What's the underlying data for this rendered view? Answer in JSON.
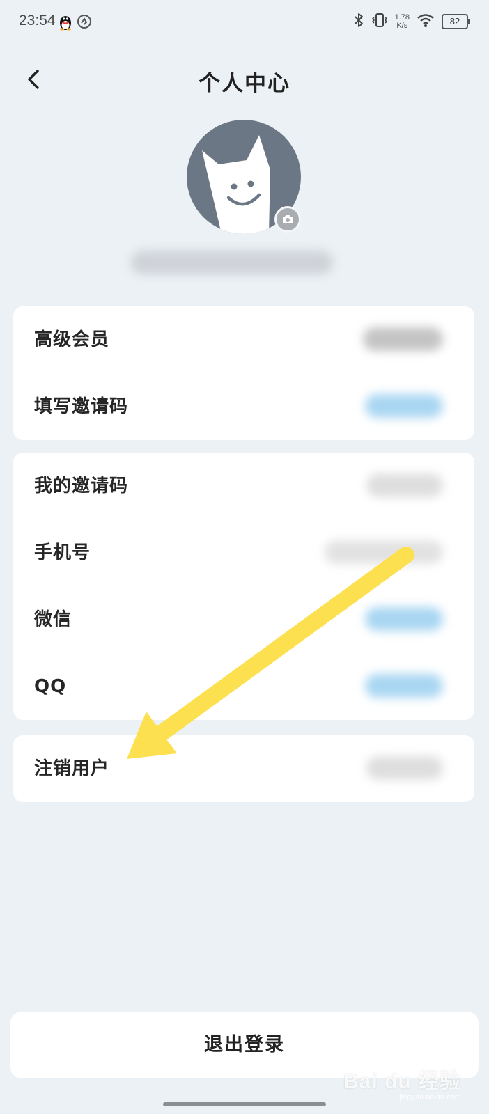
{
  "status_bar": {
    "time": "23:54",
    "net_speed_value": "1.78",
    "net_speed_unit": "K/s",
    "battery": "82",
    "left_icons": [
      "qq-penguin-icon",
      "notification-icon"
    ],
    "right_icons": [
      "bluetooth-icon",
      "vibrate-icon",
      "wifi-icon",
      "battery-icon"
    ]
  },
  "header": {
    "title": "个人中心",
    "back_icon": "chevron-left-icon"
  },
  "profile": {
    "avatar_icon": "cat-avatar-icon",
    "camera_icon": "camera-icon",
    "username": ""
  },
  "groups": [
    {
      "rows": [
        {
          "label": "高级会员",
          "value": ""
        },
        {
          "label": "填写邀请码",
          "value": ""
        }
      ]
    },
    {
      "rows": [
        {
          "label": "我的邀请码",
          "value": ""
        },
        {
          "label": "手机号",
          "value": ""
        },
        {
          "label": "微信",
          "value": ""
        },
        {
          "label": "QQ",
          "value": ""
        }
      ]
    },
    {
      "rows": [
        {
          "label": "注销用户",
          "value": ""
        }
      ]
    }
  ],
  "logout_label": "退出登录",
  "watermark": {
    "brand": "Bai du 经验",
    "url": "jingyan.baidu.com"
  },
  "colors": {
    "background": "#ecf1f5",
    "card": "#ffffff",
    "annotation_arrow": "#fde04f",
    "link_value": "#a9d6f2"
  }
}
